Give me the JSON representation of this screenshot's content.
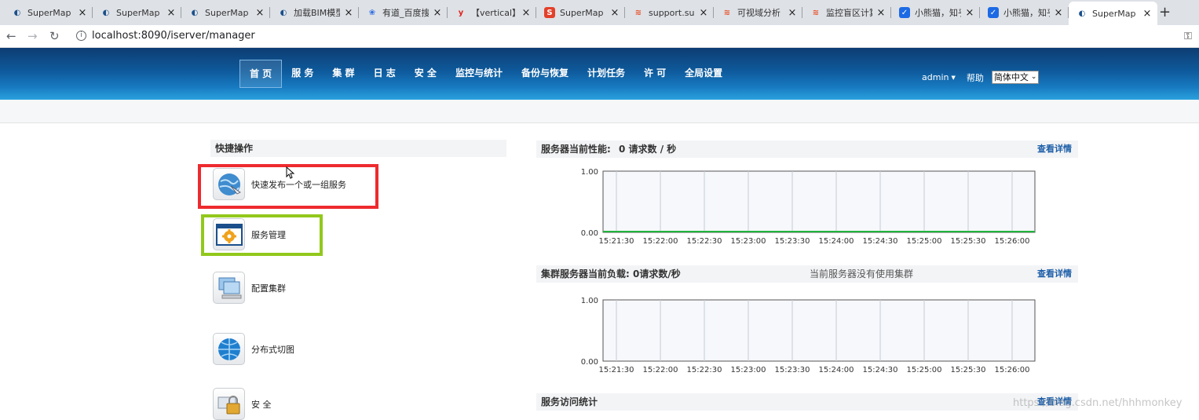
{
  "browser": {
    "tabs": [
      {
        "title": "SuperMap",
        "icon": "supermap-icon"
      },
      {
        "title": "SuperMap",
        "icon": "supermap-icon"
      },
      {
        "title": "SuperMap",
        "icon": "supermap-icon"
      },
      {
        "title": "加载BIM模型",
        "icon": "supermap-icon"
      },
      {
        "title": "有道_百度搜",
        "icon": "baidu-paw-icon"
      },
      {
        "title": "【vertical】",
        "icon": "youdao-icon"
      },
      {
        "title": "SuperMap",
        "icon": "supermap-s-icon"
      },
      {
        "title": "support.sup",
        "icon": "csdn-icon"
      },
      {
        "title": "可视域分析",
        "icon": "csdn-icon"
      },
      {
        "title": "监控盲区计算",
        "icon": "csdn-icon"
      },
      {
        "title": "小熊猫，知乎",
        "icon": "zhihu-icon"
      },
      {
        "title": "小熊猫，知乎",
        "icon": "zhihu-icon"
      },
      {
        "title": "SuperMap",
        "icon": "supermap-icon",
        "active": true
      }
    ],
    "url": "localhost:8090/iserver/manager"
  },
  "header": {
    "menu": [
      "首 页",
      "服 务",
      "集 群",
      "日 志",
      "安 全",
      "监控与统计",
      "备份与恢复",
      "计划任务",
      "许 可",
      "全局设置"
    ],
    "active_menu_index": 0,
    "user": "admin",
    "help": "帮助",
    "language": "简体中文"
  },
  "quick_ops": {
    "title": "快捷操作",
    "items": [
      {
        "label": "快速发布一个或一组服务",
        "icon": "globe-publish-icon"
      },
      {
        "label": "服务管理",
        "icon": "gear-window-icon"
      },
      {
        "label": "配置集群",
        "icon": "computer-cluster-icon"
      },
      {
        "label": "分布式切图",
        "icon": "globe-tiles-icon"
      },
      {
        "label": "安 全",
        "icon": "lock-icon"
      }
    ]
  },
  "panels": {
    "performance": {
      "title": "服务器当前性能:",
      "value": "0 请求数 / 秒",
      "detail": "查看详情"
    },
    "cluster": {
      "title": "集群服务器当前负载:",
      "value": "0请求数/秒",
      "note": "当前服务器没有使用集群",
      "detail": "查看详情"
    },
    "access": {
      "title": "服务访问统计",
      "detail": "查看详情"
    }
  },
  "chart_data": [
    {
      "type": "line",
      "x": [
        "15:21:30",
        "15:22:00",
        "15:22:30",
        "15:23:00",
        "15:23:30",
        "15:24:00",
        "15:24:30",
        "15:25:00",
        "15:25:30",
        "15:26:00"
      ],
      "ylim": [
        0,
        1
      ],
      "y_ticks": [
        "0.00",
        "1.00"
      ],
      "series": [
        {
          "values": [
            0,
            0,
            0,
            0,
            0,
            0,
            0,
            0,
            0,
            0,
            0
          ],
          "color": "#21b33c"
        }
      ]
    },
    {
      "type": "line",
      "x": [
        "15:21:30",
        "15:22:00",
        "15:22:30",
        "15:23:00",
        "15:23:30",
        "15:24:00",
        "15:24:30",
        "15:25:00",
        "15:25:30",
        "15:26:00"
      ],
      "ylim": [
        0,
        1
      ],
      "y_ticks": [
        "0.00",
        "1.00"
      ],
      "series": []
    }
  ],
  "watermark": "https://blog.csdn.net/hhhmonkey"
}
